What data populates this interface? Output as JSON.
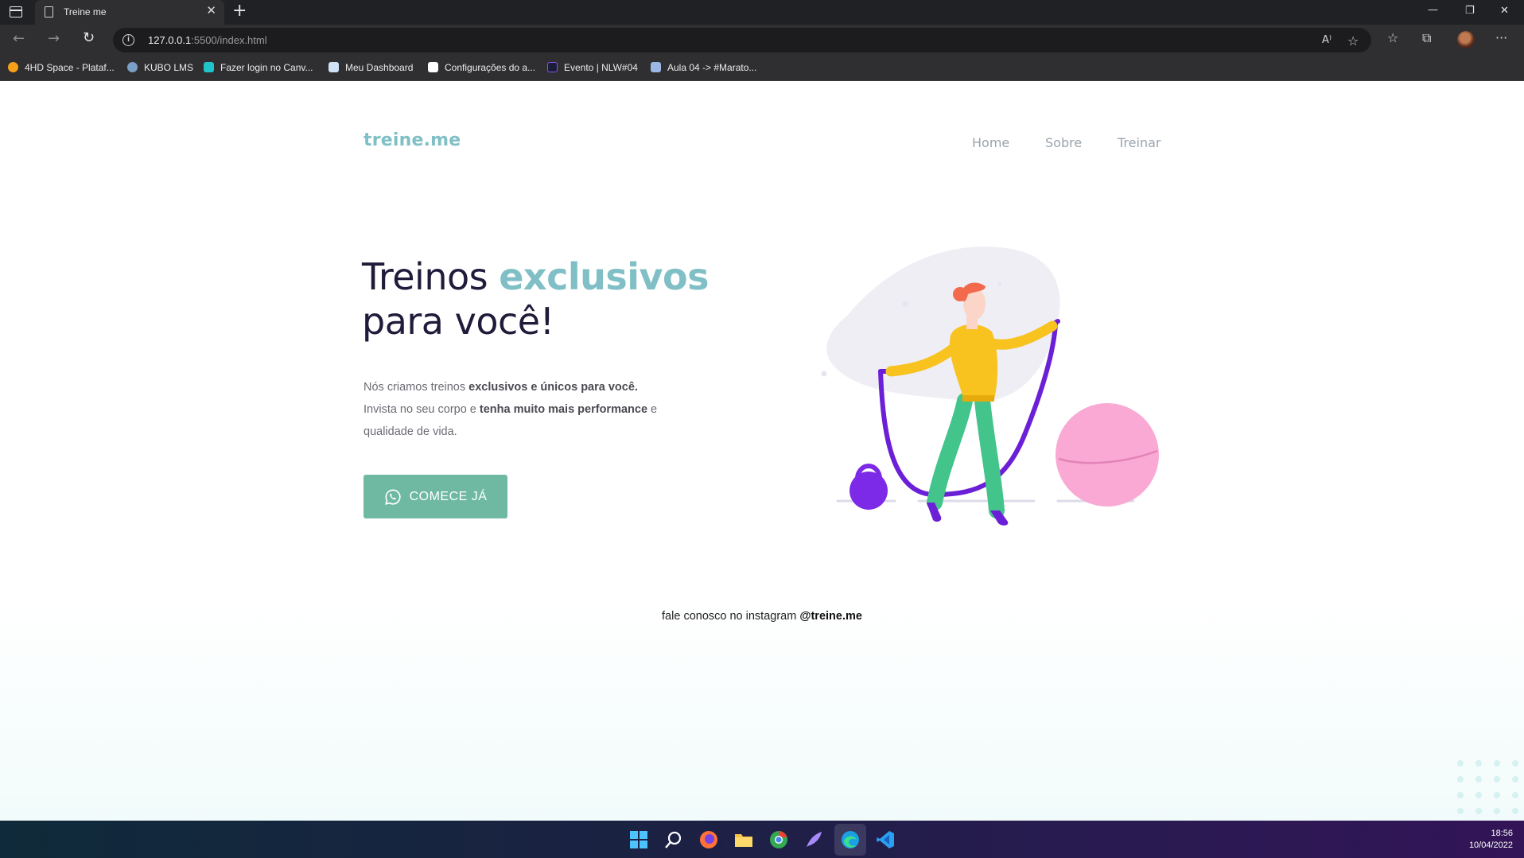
{
  "browser": {
    "tab_title": "Treine me",
    "tab_close": "✕",
    "new_tab": "+",
    "url_host": "127.0.0.1",
    "url_rest": ":5500/index.html",
    "bookmarks": [
      {
        "label": "4HD Space - Plataf...",
        "color": "#f6a01a"
      },
      {
        "label": "KUBO LMS",
        "color": "#7aa0c8"
      },
      {
        "label": "Fazer login no Canv...",
        "color": "#20c4cb"
      },
      {
        "label": "Meu Dashboard",
        "color": "#cfe3f5"
      },
      {
        "label": "Configurações do a...",
        "color": "#ffffff"
      },
      {
        "label": "Evento | NLW#04",
        "color": "#8257e5"
      },
      {
        "label": "Aula 04 -> #Marato...",
        "color": "#9ab7e6"
      }
    ]
  },
  "page": {
    "logo": "treine.me",
    "nav": {
      "home": "Home",
      "about": "Sobre",
      "train": "Treinar"
    },
    "headline": {
      "line1_prefix": "Treinos ",
      "line1_accent": "exclusivos",
      "line2": "para você!"
    },
    "description": {
      "p1": "Nós criamos treinos ",
      "b1": "exclusivos e únicos para você.",
      "p2": "Invista no seu corpo e ",
      "b2": "tenha muito mais performance",
      "p3": " e",
      "p4": "qualidade de vida."
    },
    "cta_label": "COMECE JÁ",
    "footer": {
      "prefix": "fale conosco no instagram ",
      "handle": "@treine.me"
    }
  },
  "taskbar": {
    "time": "18:56",
    "date": "10/04/2022"
  },
  "colors": {
    "accent": "#7fbfc5",
    "cta": "#6fb9a3",
    "heading": "#1f1b3a"
  }
}
